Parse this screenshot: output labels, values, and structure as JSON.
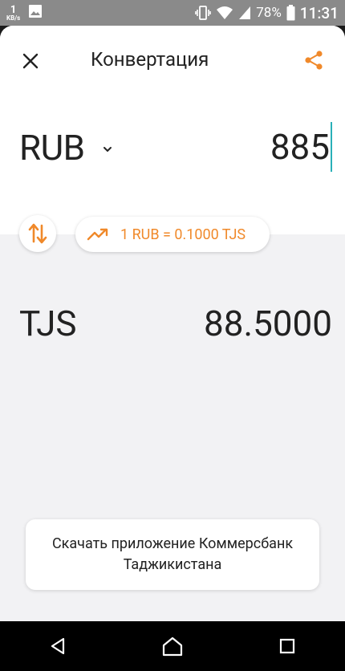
{
  "status_bar": {
    "network_speed_value": "1",
    "network_speed_unit": "KB/s",
    "battery": "78%",
    "time": "11:31"
  },
  "header": {
    "title": "Конвертация"
  },
  "from": {
    "currency": "RUB",
    "amount": "885"
  },
  "rate": {
    "text": "1 RUB = 0.1000 TJS"
  },
  "to": {
    "currency": "TJS",
    "amount": "88.5000"
  },
  "promo": {
    "download_label": "Скачать приложение Коммерсбанк Таджикистана"
  },
  "colors": {
    "accent": "#f0892a",
    "caret": "#2ab0b8"
  },
  "icons": {
    "close": "close-icon",
    "share": "share-icon",
    "dropdown": "chevron-down-icon",
    "swap": "swap-vertical-icon",
    "trend": "trending-up-icon"
  }
}
